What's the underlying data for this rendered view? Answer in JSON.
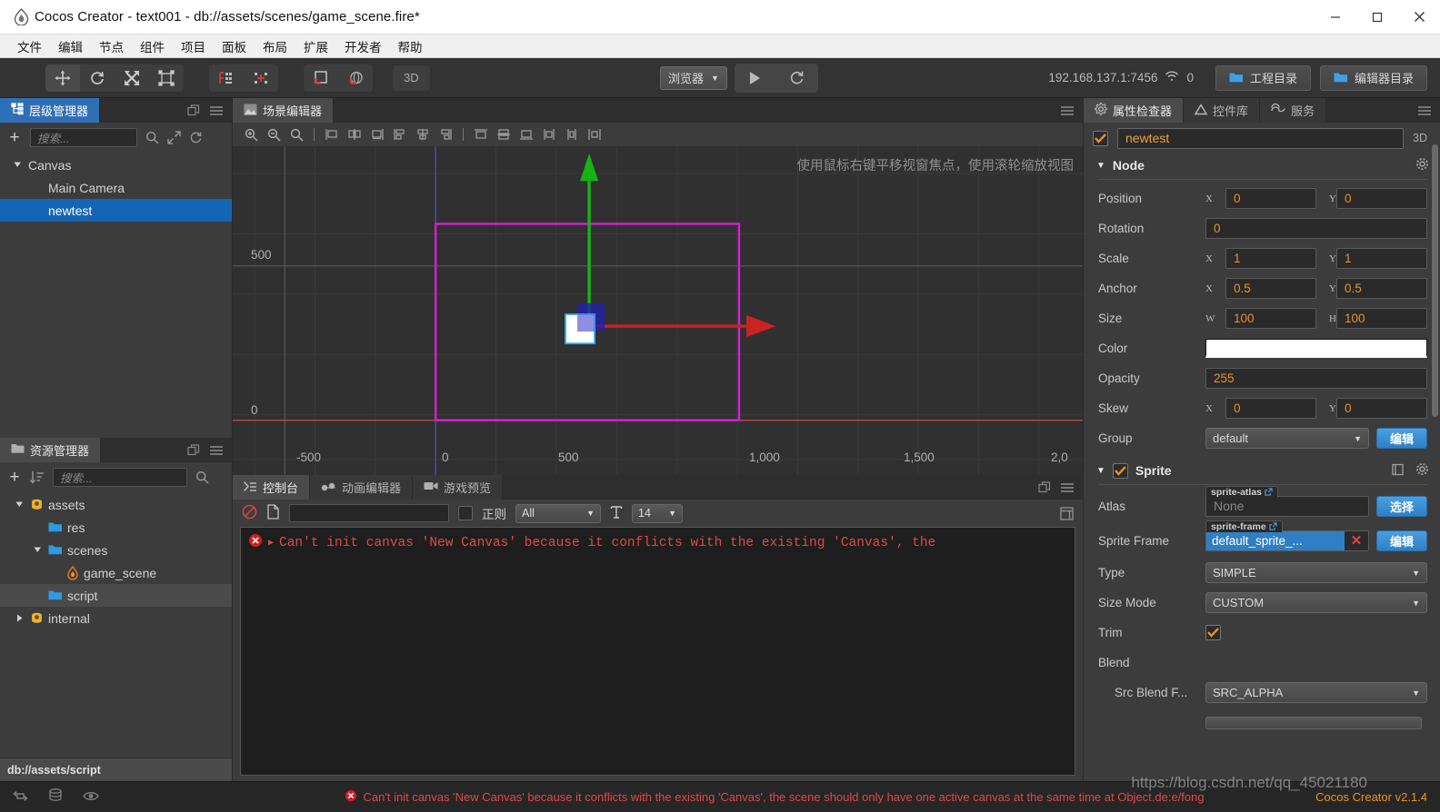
{
  "window": {
    "title": "Cocos Creator - text001 - db://assets/scenes/game_scene.fire*",
    "app_icon": "cocos-flame-icon",
    "minimize": "minimize-icon",
    "maximize": "maximize-icon",
    "close": "close-icon"
  },
  "menu": [
    "文件",
    "编辑",
    "节点",
    "组件",
    "项目",
    "面板",
    "布局",
    "扩展",
    "开发者",
    "帮助"
  ],
  "toolbar": {
    "transform_tools": [
      "move-tool",
      "rotate-tool",
      "scale-tool",
      "rect-transform-tool"
    ],
    "node_tools": [
      "align-node-icon",
      "add-node-icon"
    ],
    "pivot_tools": [
      "pivot-toggle-icon",
      "coordinate-toggle-icon"
    ],
    "mode_3d": "3D",
    "preview_target": "浏览器",
    "play_label": "play-icon",
    "refresh_label": "refresh-icon",
    "server_address": "192.168.137.1:7456",
    "wifi_icon": "wifi-icon",
    "client_count": "0",
    "project_dir_button": "工程目录",
    "editor_dir_button": "编辑器目录"
  },
  "hierarchy": {
    "tab_label": "层级管理器",
    "tab_icon": "hierarchy-icon",
    "search_placeholder": "搜索...",
    "add_icon": "plus-icon",
    "search_icon": "search-icon",
    "expand_icon": "expand-icon",
    "refresh_icon": "refresh-icon",
    "nodes": [
      {
        "label": "Canvas",
        "depth": 0,
        "expanded": true,
        "selected": false
      },
      {
        "label": "Main Camera",
        "depth": 1,
        "expanded": null,
        "selected": false
      },
      {
        "label": "newtest",
        "depth": 1,
        "expanded": null,
        "selected": true
      }
    ]
  },
  "assets": {
    "tab_label": "资源管理器",
    "tab_icon": "folder-icon",
    "search_placeholder": "搜索...",
    "add_icon": "plus-icon",
    "sort_icon": "sort-icon",
    "search_icon": "search-icon",
    "items": [
      {
        "label": "assets",
        "depth": 0,
        "icon": "db-icon",
        "expanded": true,
        "highlight": false
      },
      {
        "label": "res",
        "depth": 1,
        "icon": "folder-icon",
        "expanded": null,
        "highlight": false
      },
      {
        "label": "scenes",
        "depth": 1,
        "icon": "folder-icon",
        "expanded": true,
        "highlight": false
      },
      {
        "label": "game_scene",
        "depth": 2,
        "icon": "scene-fire-icon",
        "expanded": null,
        "highlight": false
      },
      {
        "label": "script",
        "depth": 1,
        "icon": "folder-icon",
        "expanded": null,
        "highlight": true
      },
      {
        "label": "internal",
        "depth": 0,
        "icon": "db-icon",
        "expanded": false,
        "highlight": false
      }
    ],
    "path": "db://assets/script"
  },
  "scene": {
    "tab_label": "场景编辑器",
    "tab_icon": "scene-icon",
    "tools": [
      "zoom-in-icon",
      "zoom-out-icon",
      "zoom-fit-icon",
      "align-left-icon",
      "align-center-h-icon",
      "align-right-icon",
      "distribute-left-icon",
      "distribute-center-icon",
      "distribute-right-icon",
      "align-top-icon",
      "align-middle-icon",
      "align-bottom-icon",
      "distribute-top-icon",
      "distribute-middle-icon",
      "distribute-bottom-icon"
    ],
    "hint": "使用鼠标右键平移视窗焦点，使用滚轮缩放视图",
    "ruler_x": [
      "-500",
      "0",
      "500",
      "1,000",
      "1,500",
      "2,0"
    ],
    "ruler_y": [
      "500",
      "0"
    ],
    "gizmo": {
      "x_axis_color": "#cc2222",
      "y_axis_color": "#16b316"
    }
  },
  "console": {
    "tabs": [
      {
        "label": "控制台",
        "icon": "console-icon",
        "active": true
      },
      {
        "label": "动画编辑器",
        "icon": "animation-icon",
        "active": false
      },
      {
        "label": "游戏预览",
        "icon": "camera-icon",
        "active": false
      }
    ],
    "clear_icon": "clear-icon",
    "file_icon": "file-icon",
    "filter_value": "",
    "regex_label": "正则",
    "level_filter": "All",
    "font_icon": "font-size-icon",
    "font_size": "14",
    "popout_icon": "popout-icon",
    "logs": [
      {
        "level": "error",
        "text": "Can't init canvas 'New Canvas' because it conflicts with the existing 'Canvas', the"
      }
    ]
  },
  "inspector": {
    "tabs": [
      {
        "label": "属性检查器",
        "icon": "gear-icon",
        "active": true
      },
      {
        "label": "控件库",
        "icon": "widget-icon",
        "active": false
      },
      {
        "label": "服务",
        "icon": "service-icon",
        "active": false
      }
    ],
    "node_enabled": true,
    "node_name": "newtest",
    "label_3d": "3D",
    "node_section": {
      "title": "Node",
      "gear_icon": "gear-icon"
    },
    "properties": [
      {
        "name": "Position",
        "kind": "xy",
        "x_label": "X",
        "y_label": "Y",
        "x": "0",
        "y": "0"
      },
      {
        "name": "Rotation",
        "kind": "single",
        "value": "0"
      },
      {
        "name": "Scale",
        "kind": "xy",
        "x_label": "X",
        "y_label": "Y",
        "x": "1",
        "y": "1"
      },
      {
        "name": "Anchor",
        "kind": "xy",
        "x_label": "X",
        "y_label": "Y",
        "x": "0.5",
        "y": "0.5"
      },
      {
        "name": "Size",
        "kind": "xy",
        "x_label": "W",
        "y_label": "H",
        "x": "100",
        "y": "100"
      },
      {
        "name": "Color",
        "kind": "color",
        "value": "#ffffff"
      },
      {
        "name": "Opacity",
        "kind": "single",
        "value": "255"
      },
      {
        "name": "Skew",
        "kind": "xy",
        "x_label": "X",
        "y_label": "Y",
        "x": "0",
        "y": "0"
      },
      {
        "name": "Group",
        "kind": "select-edit",
        "value": "default",
        "button": "编辑"
      }
    ],
    "sprite_section": {
      "title": "Sprite",
      "enabled": true,
      "help_icon": "help-icon",
      "gear_icon": "gear-icon",
      "atlas": {
        "name": "Atlas",
        "tag": "sprite-atlas",
        "value": "None",
        "button": "选择",
        "link_icon": "external-link-icon"
      },
      "sprite_frame": {
        "name": "Sprite Frame",
        "tag": "sprite-frame",
        "value": "default_sprite_...",
        "button": "编辑",
        "link_icon": "external-link-icon",
        "clear_icon": "clear-x-icon"
      },
      "type": {
        "name": "Type",
        "value": "SIMPLE"
      },
      "size_mode": {
        "name": "Size Mode",
        "value": "CUSTOM"
      },
      "trim": {
        "name": "Trim",
        "checked": true
      },
      "blend": {
        "name": "Blend"
      },
      "src_blend": {
        "name": "Src Blend F...",
        "value": "SRC_ALPHA"
      }
    }
  },
  "statusbar": {
    "icons": [
      "sync-icon",
      "database-icon",
      "eye-icon"
    ],
    "message": "Can't init canvas 'New Canvas' because it conflicts with the existing 'Canvas', the scene should only have one active canvas at the same time at Object.de:e/fong",
    "version": "Cocos Creator v2.1.4",
    "watermark": "https://blog.csdn.net/qq_45021180"
  }
}
